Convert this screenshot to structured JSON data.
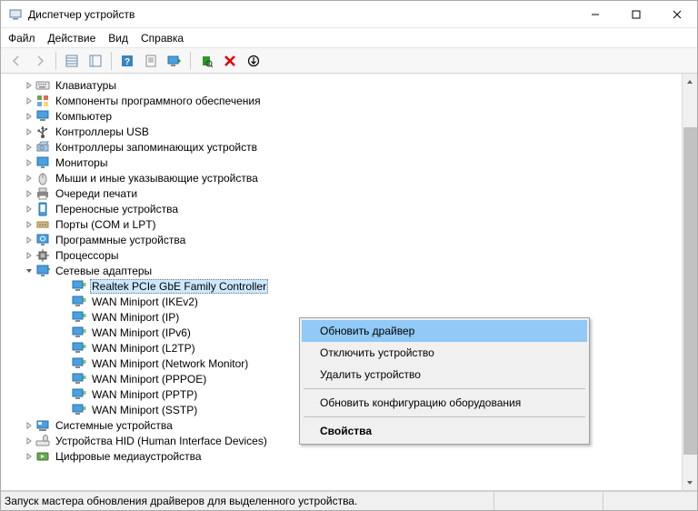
{
  "window": {
    "title": "Диспетчер устройств"
  },
  "menu": {
    "file": "Файл",
    "action": "Действие",
    "view": "Вид",
    "help": "Справка"
  },
  "tree": [
    {
      "label": "Клавиатуры",
      "icon": "keyboard",
      "depth": 1,
      "arrow": ">"
    },
    {
      "label": "Компоненты программного обеспечения",
      "icon": "component",
      "depth": 1,
      "arrow": ">"
    },
    {
      "label": "Компьютер",
      "icon": "computer",
      "depth": 1,
      "arrow": ">"
    },
    {
      "label": "Контроллеры USB",
      "icon": "usb",
      "depth": 1,
      "arrow": ">"
    },
    {
      "label": "Контроллеры запоминающих устройств",
      "icon": "storage",
      "depth": 1,
      "arrow": ">"
    },
    {
      "label": "Мониторы",
      "icon": "monitor",
      "depth": 1,
      "arrow": ">"
    },
    {
      "label": "Мыши и иные указывающие устройства",
      "icon": "mouse",
      "depth": 1,
      "arrow": ">"
    },
    {
      "label": "Очереди печати",
      "icon": "printer",
      "depth": 1,
      "arrow": ">"
    },
    {
      "label": "Переносные устройства",
      "icon": "portable",
      "depth": 1,
      "arrow": ">"
    },
    {
      "label": "Порты (COM и LPT)",
      "icon": "port",
      "depth": 1,
      "arrow": ">"
    },
    {
      "label": "Программные устройства",
      "icon": "software",
      "depth": 1,
      "arrow": ">"
    },
    {
      "label": "Процессоры",
      "icon": "cpu",
      "depth": 1,
      "arrow": ">"
    },
    {
      "label": "Сетевые адаптеры",
      "icon": "network",
      "depth": 1,
      "arrow": "v"
    },
    {
      "label": "Realtek PCIe GbE Family Controller",
      "icon": "net",
      "depth": 2,
      "selected": true
    },
    {
      "label": "WAN Miniport (IKEv2)",
      "icon": "net",
      "depth": 2
    },
    {
      "label": "WAN Miniport (IP)",
      "icon": "net",
      "depth": 2
    },
    {
      "label": "WAN Miniport (IPv6)",
      "icon": "net",
      "depth": 2
    },
    {
      "label": "WAN Miniport (L2TP)",
      "icon": "net",
      "depth": 2
    },
    {
      "label": "WAN Miniport (Network Monitor)",
      "icon": "net",
      "depth": 2
    },
    {
      "label": "WAN Miniport (PPPOE)",
      "icon": "net",
      "depth": 2
    },
    {
      "label": "WAN Miniport (PPTP)",
      "icon": "net",
      "depth": 2
    },
    {
      "label": "WAN Miniport (SSTP)",
      "icon": "net",
      "depth": 2
    },
    {
      "label": "Системные устройства",
      "icon": "system",
      "depth": 1,
      "arrow": ">"
    },
    {
      "label": "Устройства HID (Human Interface Devices)",
      "icon": "hid",
      "depth": 1,
      "arrow": ">"
    },
    {
      "label": "Цифровые медиаустройства",
      "icon": "media",
      "depth": 1,
      "arrow": ">"
    }
  ],
  "context_menu": {
    "update": "Обновить драйвер",
    "disable": "Отключить устройство",
    "delete": "Удалить устройство",
    "refresh": "Обновить конфигурацию оборудования",
    "properties": "Свойства"
  },
  "status": {
    "text": "Запуск мастера обновления драйверов для выделенного устройства."
  }
}
